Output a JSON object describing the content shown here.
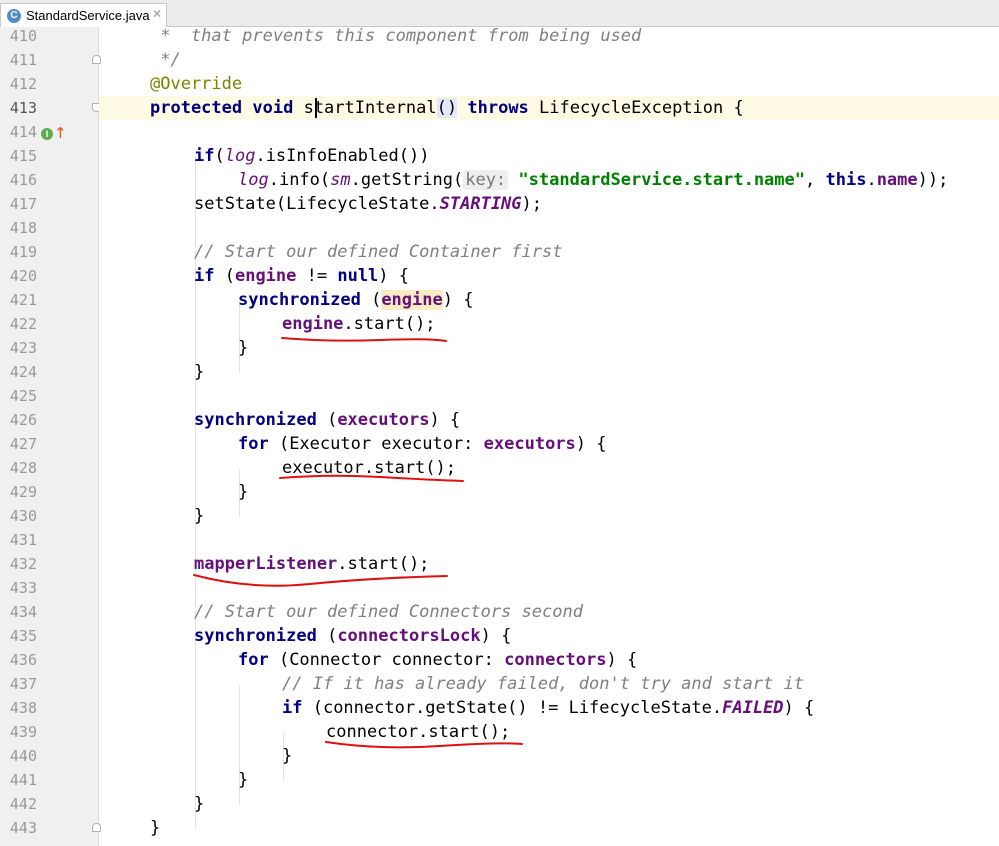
{
  "tab": {
    "filename": "StandardService.java",
    "file_icon_letter": "C",
    "close_glyph": "✕"
  },
  "gutter": {
    "line_numbers": [
      "410",
      "411",
      "412",
      "413",
      "414",
      "415",
      "416",
      "417",
      "418",
      "419",
      "420",
      "421",
      "422",
      "423",
      "424",
      "425",
      "426",
      "427",
      "428",
      "429",
      "430",
      "431",
      "432",
      "433",
      "434",
      "435",
      "436",
      "437",
      "438",
      "439",
      "440",
      "441",
      "442",
      "443"
    ],
    "caret_line": "413",
    "icons": {
      "implements_icon_letter": "I",
      "overrides_arrow": "↑"
    }
  },
  "code": {
    "l410": {
      "comment": " *  that prevents this component from being used"
    },
    "l411": {
      "comment": " */"
    },
    "l412": {
      "annotation": "@Override"
    },
    "l413": {
      "kw1": "protected",
      "kw2": "void",
      "method": "startInternal",
      "paren": "()",
      "kw3": "throws",
      "rest": " LifecycleException {"
    },
    "l415": {
      "kw": "if",
      "p1": "(",
      "field": "log",
      "rest": ".isInfoEnabled())"
    },
    "l416": {
      "field": "log",
      "a": ".info(",
      "field2": "sm",
      "b": ".getString(",
      "hint": "key:",
      "str": "\"standardService.start.name\"",
      "c": ", ",
      "kw": "this",
      "d": ".",
      "field3": "name",
      "e": "));"
    },
    "l417": {
      "a": "setState(LifecycleState.",
      "const": "STARTING",
      "b": ");"
    },
    "l419": {
      "comment": "// Start our defined Container first"
    },
    "l420": {
      "kw": "if",
      "a": " (",
      "field": "engine",
      "b": " != ",
      "kw2": "null",
      "c": ") {"
    },
    "l421": {
      "kw": "synchronized",
      "a": " (",
      "field": "engine",
      "b": ") {"
    },
    "l422": {
      "field": "engine",
      "a": ".start();"
    },
    "l423": {
      "a": "}"
    },
    "l424": {
      "a": "}"
    },
    "l426": {
      "kw": "synchronized",
      "a": " (",
      "field": "executors",
      "b": ") {"
    },
    "l427": {
      "kw": "for",
      "a": " (Executor executor: ",
      "field": "executors",
      "b": ") {"
    },
    "l428": {
      "a": "executor.start();"
    },
    "l429": {
      "a": "}"
    },
    "l430": {
      "a": "}"
    },
    "l432": {
      "field": "mapperListener",
      "a": ".start();"
    },
    "l434": {
      "comment": "// Start our defined Connectors second"
    },
    "l435": {
      "kw": "synchronized",
      "a": " (",
      "field": "connectorsLock",
      "b": ") {"
    },
    "l436": {
      "kw": "for",
      "a": " (Connector connector: ",
      "field": "connectors",
      "b": ") {"
    },
    "l437": {
      "comment": "// If it has already failed, don't try and start it"
    },
    "l438": {
      "kw": "if",
      "a": " (connector.getState() != LifecycleState.",
      "const": "FAILED",
      "b": ") {"
    },
    "l439": {
      "a": "connector.start();"
    },
    "l440": {
      "a": "}"
    },
    "l441": {
      "a": "}"
    },
    "l442": {
      "a": "}"
    },
    "l443": {
      "a": "}"
    }
  },
  "colors": {
    "keyword": "#000080",
    "field": "#660e7a",
    "string": "#008000",
    "comment": "#808080",
    "annotation": "#808000",
    "underline_mark": "#dd1111"
  }
}
